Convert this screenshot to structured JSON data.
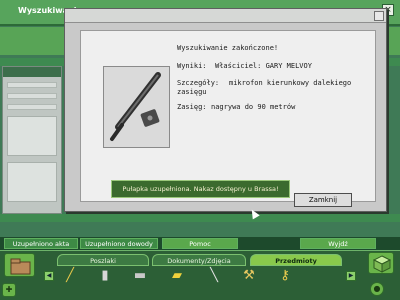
{
  "background": {
    "window_title": "Wyszukiwanie..."
  },
  "dialog": {
    "heading": "Wyszukiwanie zakończone!",
    "results_label": "Wyniki:",
    "results_value": "Właściciel: GARY MELVOY",
    "details_label": "Szczegóły:",
    "details_line1": "mikrofon kierunkowy dalekiego",
    "details_line2": "zasięgu",
    "range_label": "Zasięg:",
    "range_value": "nagrywa do 90 metrów",
    "close_button": "Zamknij"
  },
  "toast": "Pułapka uzupełniona. Nakaz dostępny u Brassa!",
  "menu": {
    "items": [
      "Uzupełniono akta",
      "Uzupełniono dowody",
      "Pomoc",
      "Wyjdź"
    ]
  },
  "tabs": [
    "Poszlaki",
    "Dokumenty/Zdjęcia",
    "Przedmioty"
  ],
  "active_tab": "Przedmioty",
  "items": [
    "screwdriver",
    "spray-can",
    "flashlight",
    "gold-bar",
    "pen",
    "tool",
    "key"
  ],
  "colors": {
    "accent_green": "#58a456",
    "active_tab": "#89c94c",
    "toast_bg": "#3b6a2e"
  }
}
